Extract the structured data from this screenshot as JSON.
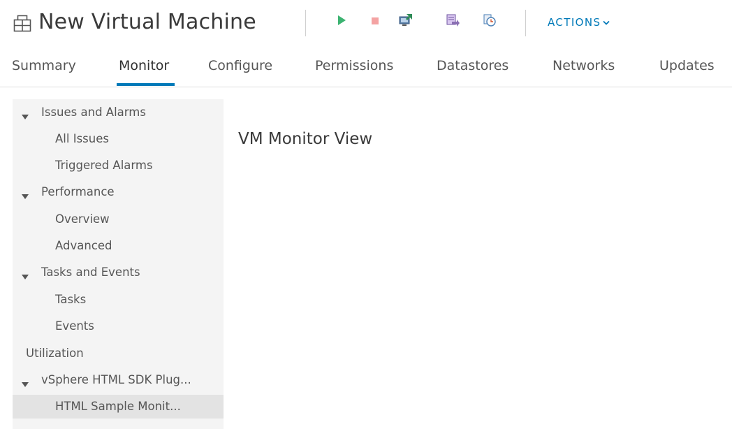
{
  "header": {
    "title": "New Virtual Machine",
    "vm_icon": "virtual-machine-icon",
    "toolbar": [
      {
        "name": "power-on-icon",
        "color": "#3cb371"
      },
      {
        "name": "power-off-icon",
        "color": "#f4a3a3"
      },
      {
        "name": "open-console-icon",
        "color": "#2e8b57"
      },
      {
        "name": "migrate-icon",
        "color": "#8a6fb3"
      },
      {
        "name": "snapshot-icon",
        "color": "#4a7fb5"
      }
    ],
    "actions_label": "ACTIONS",
    "accent_color": "#0079b8"
  },
  "tabs": [
    {
      "label": "Summary",
      "active": false
    },
    {
      "label": "Monitor",
      "active": true
    },
    {
      "label": "Configure",
      "active": false
    },
    {
      "label": "Permissions",
      "active": false
    },
    {
      "label": "Datastores",
      "active": false
    },
    {
      "label": "Networks",
      "active": false
    },
    {
      "label": "Updates",
      "active": false
    }
  ],
  "nav": {
    "groups": [
      {
        "label": "Issues and Alarms",
        "expanded": true,
        "items": [
          {
            "label": "All Issues",
            "selected": false
          },
          {
            "label": "Triggered Alarms",
            "selected": false
          }
        ]
      },
      {
        "label": "Performance",
        "expanded": true,
        "items": [
          {
            "label": "Overview",
            "selected": false
          },
          {
            "label": "Advanced",
            "selected": false
          }
        ]
      },
      {
        "label": "Tasks and Events",
        "expanded": true,
        "items": [
          {
            "label": "Tasks",
            "selected": false
          },
          {
            "label": "Events",
            "selected": false
          }
        ]
      }
    ],
    "utilization_label": "Utilization",
    "plugin_group": {
      "label": "vSphere HTML SDK Plug...",
      "expanded": true,
      "items": [
        {
          "label": "HTML Sample Monit...",
          "selected": true
        }
      ]
    }
  },
  "content": {
    "title": "VM Monitor View"
  }
}
